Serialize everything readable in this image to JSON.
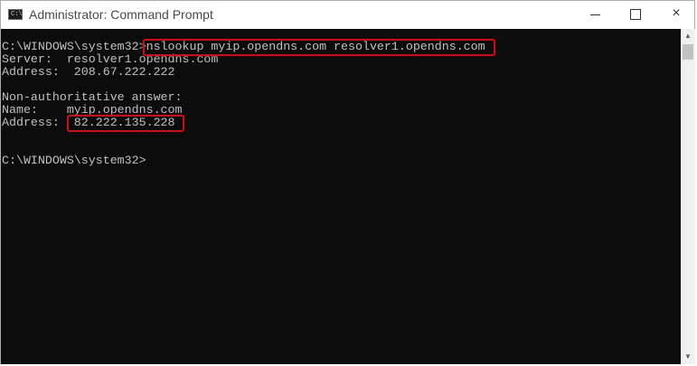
{
  "window": {
    "title": "Administrator: Command Prompt",
    "app_icon_glyph": "C:\\",
    "controls": {
      "minimize": "minimize-icon",
      "maximize": "maximize-icon",
      "close": "×"
    }
  },
  "console": {
    "lines": [
      "C:\\WINDOWS\\system32>nslookup myip.opendns.com resolver1.opendns.com",
      "Server:  resolver1.opendns.com",
      "Address:  208.67.222.222",
      "",
      "Non-authoritative answer:",
      "Name:    myip.opendns.com",
      "Address:  82.222.135.228",
      "",
      "",
      "C:\\WINDOWS\\system32>"
    ],
    "colors": {
      "background": "#0c0c0c",
      "text": "#c0c0c0",
      "highlight": "#c1121f"
    }
  },
  "scrollbar": {
    "up": "▲",
    "down": "▼"
  }
}
